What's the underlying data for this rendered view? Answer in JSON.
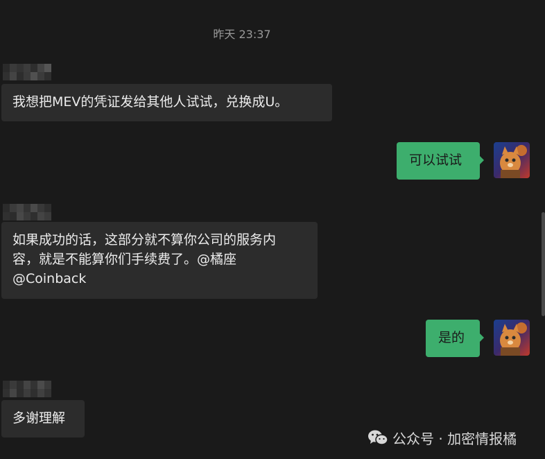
{
  "timestamp": "昨天 23:37",
  "messages": [
    {
      "direction": "in",
      "text": "我想把MEV的凭证发给其他人试试，兑换成U。"
    },
    {
      "direction": "out",
      "text": "可以试试"
    },
    {
      "direction": "in",
      "text_lines": [
        "如果成功的话，这部分就不算你公司的服务内",
        "容，就是不能算你们手续费了。@橘座",
        "@Coinback"
      ]
    },
    {
      "direction": "out",
      "text": "是的"
    },
    {
      "direction": "in",
      "text": "多谢理解"
    }
  ],
  "watermark": {
    "icon": "wechat-icon",
    "text": "公众号 · 加密情报橘"
  },
  "colors": {
    "background": "#1a1a1a",
    "incoming_bubble": "#2c2c2c",
    "outgoing_bubble": "#3dae6d"
  }
}
